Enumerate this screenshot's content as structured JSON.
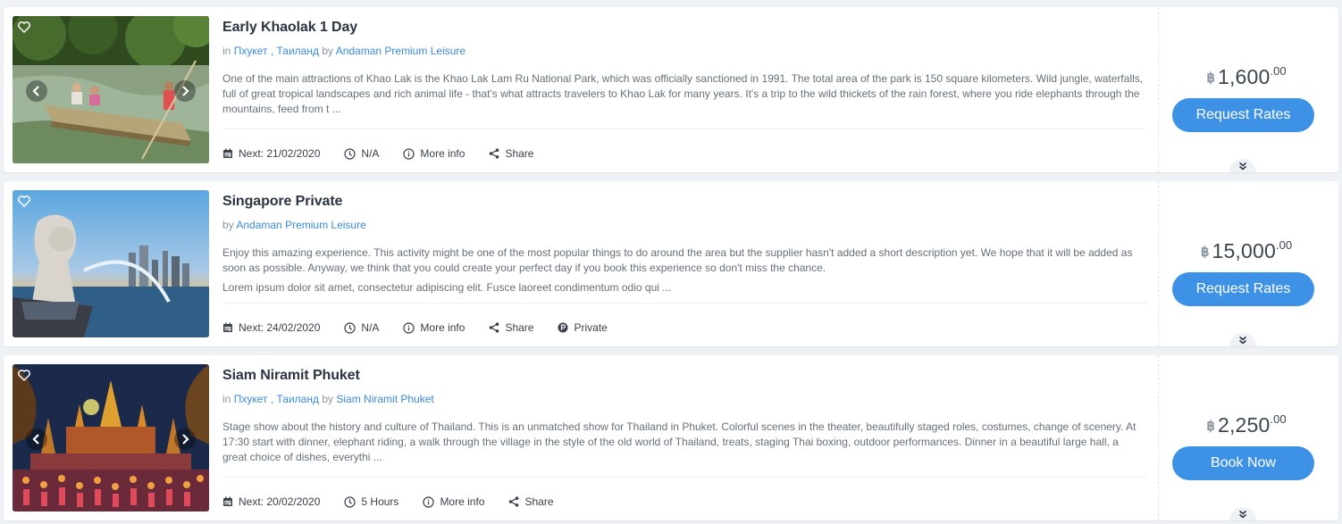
{
  "listings": [
    {
      "title": "Early Khaolak 1 Day",
      "loc_in": "in",
      "city": "Пхукет",
      "loc_comma": ",",
      "country": "Таиланд",
      "by_text": "by",
      "supplier": "Andaman Premium Leisure",
      "description": "One of the main attractions of Khao Lak is the Khao Lak Lam Ru National Park, which was officially sanctioned in 1991. The total area of the park is 150 square kilometers. Wild jungle, waterfalls, full of great tropical landscapes and rich animal life - that's what attracts travelers to Khao Lak for many years. It's a trip to the wild thickets of the rain forest, where you ride elephants through the mountains, feed from t ...",
      "next": "Next: 21/02/2020",
      "duration": "N/A",
      "more_info": "More info",
      "share": "Share",
      "currency": "฿",
      "price": "1,600",
      "price_dec": ".00",
      "action": "Request Rates"
    },
    {
      "title": "Singapore Private",
      "by_text": "by",
      "supplier": "Andaman Premium Leisure",
      "description": "Enjoy this amazing experience. This activity might be one of the most popular things to do around the area but the supplier hasn't added a short description yet. We hope that it will be added as soon as possible. Anyway, we think that you could create your perfect day if you book this experience so don't miss the chance.",
      "description2": "Lorem ipsum dolor sit amet, consectetur adipiscing elit. Fusce laoreet condimentum odio qui ...",
      "next": "Next: 24/02/2020",
      "duration": "N/A",
      "more_info": "More info",
      "share": "Share",
      "private": "Private",
      "currency": "฿",
      "price": "15,000",
      "price_dec": ".00",
      "action": "Request Rates"
    },
    {
      "title": "Siam Niramit Phuket",
      "loc_in": "in",
      "city": "Пхукет",
      "loc_comma": ",",
      "country": "Таиланд",
      "by_text": "by",
      "supplier": "Siam Niramit Phuket",
      "description": "Stage show about the history and culture of Thailand. This is an unmatched show for Thailand in Phuket. Colorful scenes in the theater, beautifully staged roles, costumes, change of scenery. At 17:30 start with dinner, elephant riding, a walk through the village in the style of the old world of Thailand, treats, staging Thai boxing, outdoor performances. Dinner in a beautiful large hall, a great choice of dishes, everythi ...",
      "next": "Next: 20/02/2020",
      "duration": "5 Hours",
      "more_info": "More info",
      "share": "Share",
      "currency": "฿",
      "price": "2,250",
      "price_dec": ".00",
      "action": "Book Now"
    }
  ],
  "colors": {
    "accent": "#3d92e5",
    "link": "#3a8ad8",
    "title": "#2b3440",
    "background": "#eef1f5"
  },
  "icons": {
    "favorite": "heart-icon",
    "prev": "chevron-left-icon",
    "next": "chevron-right-icon",
    "date": "calendar-icon",
    "duration": "clock-icon",
    "info": "info-circle-icon",
    "share": "share-icon",
    "private": "private-badge-icon",
    "expand": "double-chevron-down-icon"
  }
}
